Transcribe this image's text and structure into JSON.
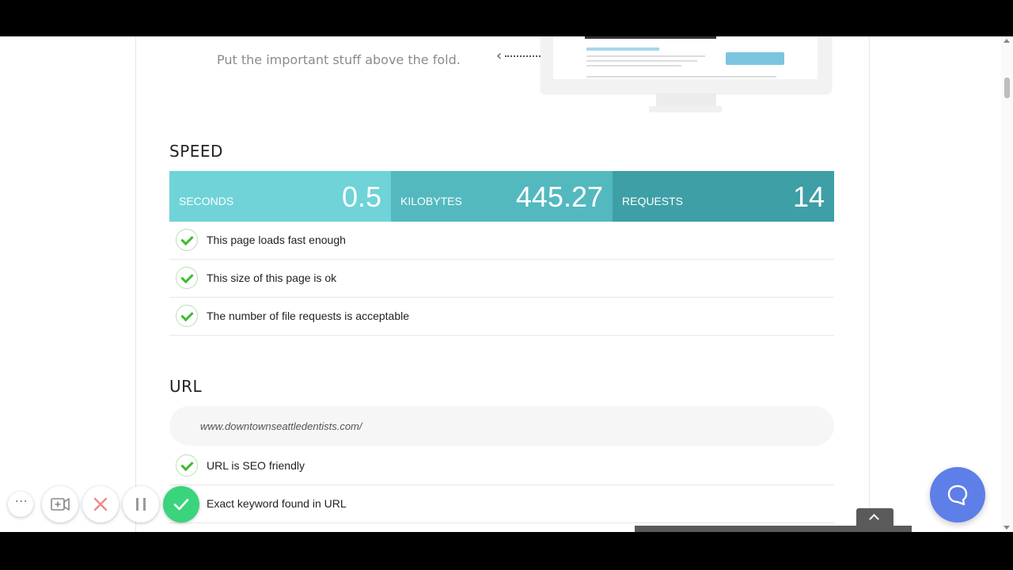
{
  "fold": {
    "tip": "Put the important stuff above the fold."
  },
  "speed": {
    "title": "SPEED",
    "metrics": [
      {
        "label": "SECONDS",
        "value": "0.5",
        "color": "#6fd3d8"
      },
      {
        "label": "KILOBYTES",
        "value": "445.27",
        "color": "#53b9bf"
      },
      {
        "label": "REQUESTS",
        "value": "14",
        "color": "#3e9fa6"
      }
    ],
    "checks": [
      "This page loads fast enough",
      "This size of this page is ok",
      "The number of file requests is acceptable"
    ]
  },
  "url": {
    "title": "URL",
    "value": "www.downtownseattledentists.com/",
    "checks": [
      "URL is SEO friendly",
      "Exact keyword found in URL"
    ]
  },
  "icons": {
    "check": "check-icon",
    "chat": "chat-bubble-icon",
    "back_to_top": "chevron-up-icon",
    "recorder": [
      "more-icon",
      "camera-add-icon",
      "close-icon",
      "pause-icon",
      "checkmark-icon"
    ]
  },
  "colors": {
    "check_green": "#3bbd2f",
    "chat_blue": "#5e7ee8",
    "record_done_green": "#3ad47c"
  }
}
